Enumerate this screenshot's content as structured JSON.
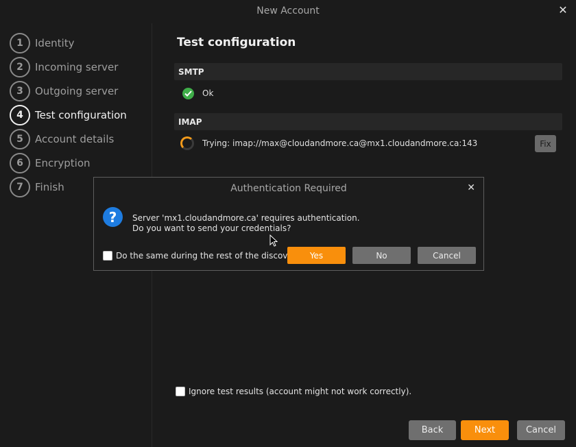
{
  "window": {
    "title": "New Account",
    "close_glyph": "✕"
  },
  "steps": [
    {
      "num": "1",
      "label": "Identity",
      "active": false
    },
    {
      "num": "2",
      "label": "Incoming server",
      "active": false
    },
    {
      "num": "3",
      "label": "Outgoing server",
      "active": false
    },
    {
      "num": "4",
      "label": "Test configuration",
      "active": true
    },
    {
      "num": "5",
      "label": "Account details",
      "active": false
    },
    {
      "num": "6",
      "label": "Encryption",
      "active": false
    },
    {
      "num": "7",
      "label": "Finish",
      "active": false
    }
  ],
  "main": {
    "heading": "Test configuration",
    "smtp": {
      "label": "SMTP",
      "status_text": "Ok",
      "icon": "check-circle-icon"
    },
    "imap": {
      "label": "IMAP",
      "status_text": "Trying: imap://max@cloudandmore.ca@mx1.cloudandmore.ca:143",
      "icon": "spinner-icon",
      "fix_label": "Fix"
    },
    "ignore_label": "Ignore test results (account might not work correctly)."
  },
  "dialog": {
    "title": "Authentication Required",
    "close_glyph": "✕",
    "message_line1": "Server 'mx1.cloudandmore.ca' requires authentication.",
    "message_line2": "Do you want to send your credentials?",
    "checkbox_label": "Do the same during the rest of the discovery.",
    "yes_label": "Yes",
    "no_label": "No",
    "cancel_label": "Cancel",
    "icon": "question-icon"
  },
  "footer": {
    "back_label": "Back",
    "next_label": "Next",
    "cancel_label": "Cancel"
  },
  "colors": {
    "accent": "#f98f0c",
    "success": "#3fae49",
    "info": "#1e7ce0",
    "background": "#1b1b1b"
  }
}
